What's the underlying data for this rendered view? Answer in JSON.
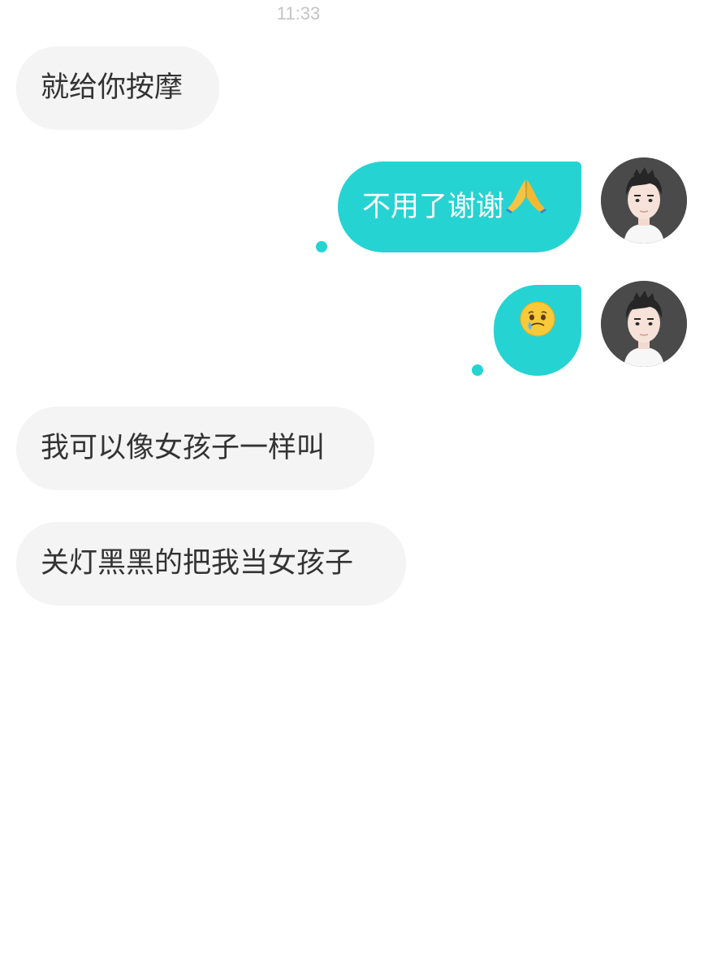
{
  "status": {
    "time": "11:33"
  },
  "messages": [
    {
      "side": "incoming",
      "text": "就给你按摩"
    },
    {
      "side": "outgoing",
      "text": "不用了谢谢",
      "emoji": "folded-hands"
    },
    {
      "side": "outgoing",
      "text": "",
      "emoji": "face-holding-back-tears"
    },
    {
      "side": "incoming",
      "text": "我可以像女孩子一样叫"
    },
    {
      "side": "incoming",
      "text": "关灯黑黑的把我当女孩子"
    }
  ],
  "colors": {
    "outgoing_bubble": "#26d3d3",
    "incoming_bubble": "#f4f4f4",
    "incoming_text": "#333333",
    "timestamp": "#c4c4c4"
  }
}
